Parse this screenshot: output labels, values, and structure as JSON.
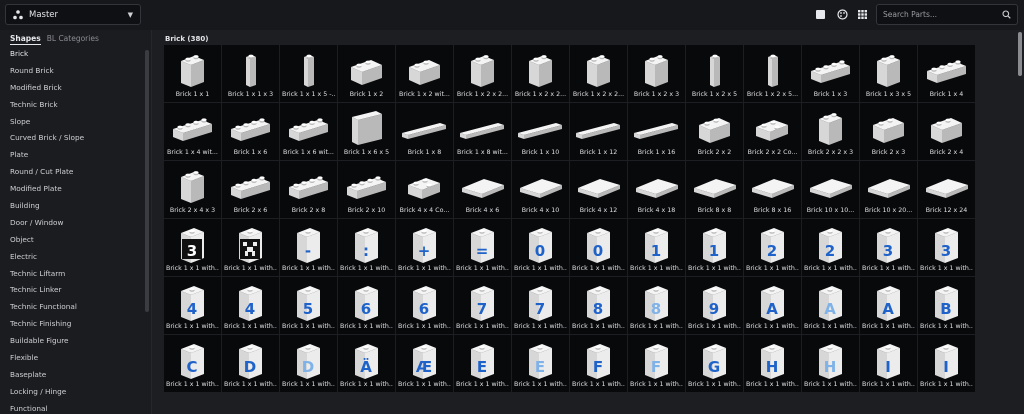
{
  "topbar": {
    "master_label": "Master",
    "search_placeholder": "Search Parts...",
    "icons": [
      "master-logo-icon",
      "chevron-down-icon",
      "single-view-icon",
      "palette-icon",
      "grid-view-icon",
      "search-icon"
    ]
  },
  "sidebar": {
    "tabs": [
      {
        "label": "Shapes",
        "active": true
      },
      {
        "label": "BL Categories",
        "active": false
      }
    ],
    "categories": [
      "Brick",
      "Round Brick",
      "Modified Brick",
      "Technic Brick",
      "Slope",
      "Curved Brick / Slope",
      "Plate",
      "Round / Cut Plate",
      "Modified Plate",
      "Building",
      "Door / Window",
      "Object",
      "Electric",
      "Technic Liftarm",
      "Technic Linker",
      "Technic Functional",
      "Technic Finishing",
      "Buildable Figure",
      "Flexible",
      "Baseplate",
      "Locking / Hinge",
      "Functional"
    ]
  },
  "main": {
    "section_title": "Brick (380)",
    "parts": [
      {
        "label": "Brick 1 x 1",
        "shape": "tall"
      },
      {
        "label": "Brick 1 x 1 x 3",
        "shape": "pillar"
      },
      {
        "label": "Brick 1 x 1 x 5 -...",
        "shape": "pillar"
      },
      {
        "label": "Brick 1 x 2",
        "shape": "block"
      },
      {
        "label": "Brick 1 x 2 wit...",
        "shape": "block"
      },
      {
        "label": "Brick 1 x 2 x 2...",
        "shape": "tall"
      },
      {
        "label": "Brick 1 x 2 x 2...",
        "shape": "tall"
      },
      {
        "label": "Brick 1 x 2 x 2...",
        "shape": "tall"
      },
      {
        "label": "Brick 1 x 2 x 3",
        "shape": "tall"
      },
      {
        "label": "Brick 1 x 2 x 5",
        "shape": "pillar"
      },
      {
        "label": "Brick 1 x 2 x 5...",
        "shape": "pillar"
      },
      {
        "label": "Brick 1 x 3",
        "shape": "long"
      },
      {
        "label": "Brick 1 x 3 x 5",
        "shape": "tall"
      },
      {
        "label": "Brick 1 x 4",
        "shape": "long"
      },
      {
        "label": "Brick 1 x 4 wit...",
        "shape": "long"
      },
      {
        "label": "Brick 1 x 6",
        "shape": "long"
      },
      {
        "label": "Brick 1 x 6 wit...",
        "shape": "long"
      },
      {
        "label": "Brick 1 x 6 x 5",
        "shape": "wall"
      },
      {
        "label": "Brick 1 x 8",
        "shape": "bar"
      },
      {
        "label": "Brick 1 x 8 wit...",
        "shape": "bar"
      },
      {
        "label": "Brick 1 x 10",
        "shape": "bar"
      },
      {
        "label": "Brick 1 x 12",
        "shape": "bar"
      },
      {
        "label": "Brick 1 x 16",
        "shape": "bar"
      },
      {
        "label": "Brick 2 x 2",
        "shape": "block"
      },
      {
        "label": "Brick 2 x 2 Co...",
        "shape": "corner"
      },
      {
        "label": "Brick 2 x 2 x 3",
        "shape": "tall"
      },
      {
        "label": "Brick 2 x 3",
        "shape": "block"
      },
      {
        "label": "Brick 2 x 4",
        "shape": "block"
      },
      {
        "label": "Brick 2 x 4 x 3",
        "shape": "tall"
      },
      {
        "label": "Brick 2 x 6",
        "shape": "long"
      },
      {
        "label": "Brick 2 x 8",
        "shape": "long"
      },
      {
        "label": "Brick 2 x 10",
        "shape": "long"
      },
      {
        "label": "Brick 4 x 4 Co...",
        "shape": "corner"
      },
      {
        "label": "Brick 4 x 6",
        "shape": "flat"
      },
      {
        "label": "Brick 4 x 10",
        "shape": "flat"
      },
      {
        "label": "Brick 4 x 12",
        "shape": "flat"
      },
      {
        "label": "Brick 4 x 18",
        "shape": "flat"
      },
      {
        "label": "Brick 8 x 8",
        "shape": "flat"
      },
      {
        "label": "Brick 8 x 16",
        "shape": "flat"
      },
      {
        "label": "Brick 10 x 10...",
        "shape": "flat"
      },
      {
        "label": "Brick 10 x 20...",
        "shape": "flat"
      },
      {
        "label": "Brick 12 x 24",
        "shape": "flat"
      },
      {
        "label": "Brick 1 x 1 with...",
        "shape": "print",
        "glyph": "3",
        "print": "black"
      },
      {
        "label": "Brick 1 x 1 with...",
        "shape": "print",
        "glyph": "creeper",
        "print": "black"
      },
      {
        "label": "Brick 1 x 1 with...",
        "shape": "print",
        "glyph": "-",
        "print": "blue"
      },
      {
        "label": "Brick 1 x 1 with...",
        "shape": "print",
        "glyph": ":",
        "print": "blue"
      },
      {
        "label": "Brick 1 x 1 with...",
        "shape": "print",
        "glyph": "+",
        "print": "blue"
      },
      {
        "label": "Brick 1 x 1 with...",
        "shape": "print",
        "glyph": "=",
        "print": "blue"
      },
      {
        "label": "Brick 1 x 1 with...",
        "shape": "print",
        "glyph": "0",
        "print": "blue"
      },
      {
        "label": "Brick 1 x 1 with...",
        "shape": "print",
        "glyph": "0",
        "print": "blue"
      },
      {
        "label": "Brick 1 x 1 with...",
        "shape": "print",
        "glyph": "1",
        "print": "blue"
      },
      {
        "label": "Brick 1 x 1 with...",
        "shape": "print",
        "glyph": "1",
        "print": "blue"
      },
      {
        "label": "Brick 1 x 1 with...",
        "shape": "print",
        "glyph": "2",
        "print": "blue"
      },
      {
        "label": "Brick 1 x 1 with...",
        "shape": "print",
        "glyph": "2",
        "print": "blue"
      },
      {
        "label": "Brick 1 x 1 with...",
        "shape": "print",
        "glyph": "3",
        "print": "blue"
      },
      {
        "label": "Brick 1 x 1 with...",
        "shape": "print",
        "glyph": "3",
        "print": "blue"
      },
      {
        "label": "Brick 1 x 1 with...",
        "shape": "print",
        "glyph": "4",
        "print": "blue"
      },
      {
        "label": "Brick 1 x 1 with...",
        "shape": "print",
        "glyph": "4",
        "print": "blue"
      },
      {
        "label": "Brick 1 x 1 with...",
        "shape": "print",
        "glyph": "5",
        "print": "blue"
      },
      {
        "label": "Brick 1 x 1 with...",
        "shape": "print",
        "glyph": "6",
        "print": "blue"
      },
      {
        "label": "Brick 1 x 1 with...",
        "shape": "print",
        "glyph": "6",
        "print": "blue"
      },
      {
        "label": "Brick 1 x 1 with...",
        "shape": "print",
        "glyph": "7",
        "print": "blue"
      },
      {
        "label": "Brick 1 x 1 with...",
        "shape": "print",
        "glyph": "7",
        "print": "blue"
      },
      {
        "label": "Brick 1 x 1 with...",
        "shape": "print",
        "glyph": "8",
        "print": "blue"
      },
      {
        "label": "Brick 1 x 1 with...",
        "shape": "print",
        "glyph": "8",
        "print": "lightblue"
      },
      {
        "label": "Brick 1 x 1 with...",
        "shape": "print",
        "glyph": "9",
        "print": "blue"
      },
      {
        "label": "Brick 1 x 1 with...",
        "shape": "print",
        "glyph": "A",
        "print": "blue"
      },
      {
        "label": "Brick 1 x 1 with...",
        "shape": "print",
        "glyph": "A",
        "print": "lightblue"
      },
      {
        "label": "Brick 1 x 1 with...",
        "shape": "print",
        "glyph": "A",
        "print": "blue"
      },
      {
        "label": "Brick 1 x 1 with...",
        "shape": "print",
        "glyph": "B",
        "print": "blue"
      },
      {
        "label": "Brick 1 x 1 with...",
        "shape": "print",
        "glyph": "C",
        "print": "blue"
      },
      {
        "label": "Brick 1 x 1 with...",
        "shape": "print",
        "glyph": "D",
        "print": "blue"
      },
      {
        "label": "Brick 1 x 1 with...",
        "shape": "print",
        "glyph": "D",
        "print": "lightblue"
      },
      {
        "label": "Brick 1 x 1 with...",
        "shape": "print",
        "glyph": "Ä",
        "print": "blue"
      },
      {
        "label": "Brick 1 x 1 with...",
        "shape": "print",
        "glyph": "Æ",
        "print": "blue"
      },
      {
        "label": "Brick 1 x 1 with...",
        "shape": "print",
        "glyph": "E",
        "print": "blue"
      },
      {
        "label": "Brick 1 x 1 with...",
        "shape": "print",
        "glyph": "E",
        "print": "lightblue"
      },
      {
        "label": "Brick 1 x 1 with...",
        "shape": "print",
        "glyph": "F",
        "print": "blue"
      },
      {
        "label": "Brick 1 x 1 with...",
        "shape": "print",
        "glyph": "F",
        "print": "lightblue"
      },
      {
        "label": "Brick 1 x 1 with...",
        "shape": "print",
        "glyph": "G",
        "print": "blue"
      },
      {
        "label": "Brick 1 x 1 with...",
        "shape": "print",
        "glyph": "H",
        "print": "blue"
      },
      {
        "label": "Brick 1 x 1 with...",
        "shape": "print",
        "glyph": "H",
        "print": "lightblue"
      },
      {
        "label": "Brick 1 x 1 with...",
        "shape": "print",
        "glyph": "I",
        "print": "blue"
      },
      {
        "label": "Brick 1 x 1 with...",
        "shape": "print",
        "glyph": "I",
        "print": "blue"
      }
    ]
  },
  "colors": {
    "tile_bg": "#08090b",
    "brick_top": "#f4f4f4",
    "brick_front": "#d7d7d7",
    "brick_side": "#b9b9b9",
    "print_blue": "#1f62c9",
    "print_lightblue": "#7fb2e8",
    "print_black": "#101010"
  }
}
